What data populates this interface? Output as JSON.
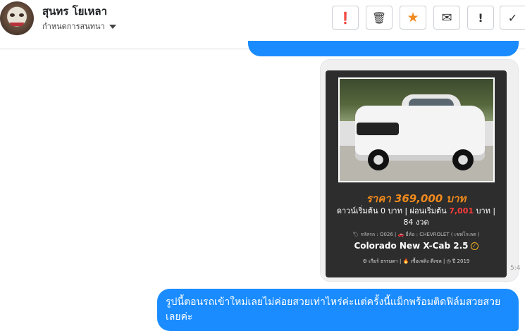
{
  "header": {
    "name": "สุนทร โยเหลา",
    "subtitle": "กำหนดการสนทนา",
    "actions": [
      {
        "name": "report-button",
        "icon": "exclamation-circle-icon",
        "glyph": "❗"
      },
      {
        "name": "delete-button",
        "icon": "trash-icon",
        "glyph": "🗑"
      },
      {
        "name": "star-button",
        "icon": "star-icon",
        "glyph": "★",
        "color": "#f08a1c"
      },
      {
        "name": "mail-button",
        "icon": "envelope-icon",
        "glyph": "✉"
      },
      {
        "name": "important-button",
        "icon": "exclamation-icon",
        "glyph": "!"
      },
      {
        "name": "done-button",
        "icon": "check-icon",
        "glyph": "✓"
      }
    ]
  },
  "card": {
    "price": "ราคา 369,000 บาท",
    "down_payment_prefix": "ดาวน์เริ่มต้น 0 บาท | ผ่อนเริ่มต้น ",
    "installment": "7,001",
    "installment_suffix": " บาท | 84 งวด",
    "code_line": "🏷 รหัสรถ : O026 | 🚗 ยี่ห้อ : CHEVROLET ( เชฟโรเลต )",
    "model": "Colorado New X-Cab 2.5",
    "specs": "⚙ เกียร์ ธรรมดา  |  🔥 เชื้อเพลิง ดีเซล  |  ◷ ปี 2019"
  },
  "time_partial": "5:4",
  "message": "รูปนี้ตอนรถเข้าใหม่เลยไม่ค่อยสวยเท่าไหร่ค่ะแต่ครั้งนี้แม็กพร้อมติดฟิล์มสวยสวยเลยค่ะ",
  "colors": {
    "bubble": "#1a8cff",
    "price": "#f08a1c",
    "installment": "#ff3b3b"
  }
}
